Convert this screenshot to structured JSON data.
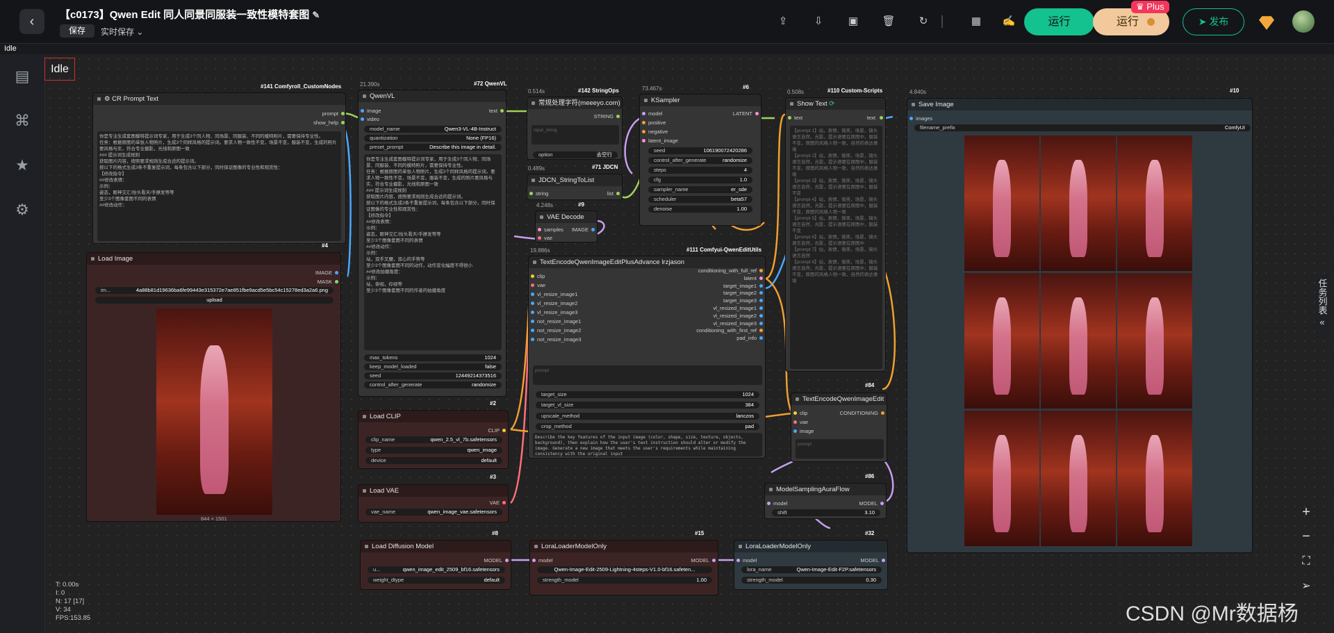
{
  "topbar": {
    "title": "【c0173】Qwen Edit 同人同景同服装一致性模特套图",
    "save": "保存",
    "autosave": "实时保存",
    "run": "运行",
    "run_plus": "运行",
    "plus_badge": "Plus",
    "publish": "发布"
  },
  "status": {
    "idle_small": "Idle",
    "idle": "Idle"
  },
  "stats": {
    "t": "T: 0.00s",
    "i": "I: 0",
    "n": "N: 17 [17]",
    "v": "V: 34",
    "fps": "FPS:153.85"
  },
  "sidebar": {
    "tasklist": "任务列表"
  },
  "watermark": "CSDN @Mr数据杨",
  "nodes": {
    "cr_prompt": {
      "id": "#141 Comfyroll_CustomNodes",
      "title": "CR Prompt Text",
      "out1": "prompt",
      "out2": "show_help",
      "text": "你是专注生成套图模特提示词专家，用于生成3个同人物、同场景、同服装、不同的模特照片，需要保持专业性。\n任务：根据原图的单张人物照片，生成3个同样风格的提示词。要求人物一致性不变，场景不变，服装不变，生成的照片要风格与实，符合专业摄影，光线和原图一致\n### 提示词生成规则\n获取图片内容，按照要求规则生成合适的提示词。\n按以下的格式生成3条不重复提示词，每条包含以下部分，同时保证图像的专业性和观赏性：\n【修改指令】\n##修改表情：\n示例：\n姿态，眼神交汇/抬头看天/手撩发等等\n至少3个图像套图不同的表情\n##修改动作："
    },
    "qwenvl": {
      "id": "#72 QwenVL",
      "time": "21.390s",
      "title": "QwenVL",
      "in1": "image",
      "in2": "video",
      "out1": "text",
      "model_name": "Qwen3-VL-4B-Instruct",
      "quantization": "None (FP16)",
      "preset_prompt": "Describe this image in detail.",
      "max_tokens": "1024",
      "keep_model_loaded": "false",
      "seed": "12449214373516",
      "control_after_generate": "randomize",
      "w_model_name": "model_name",
      "w_quantization": "quantization",
      "w_preset_prompt": "preset_prompt",
      "w_max_tokens": "max_tokens",
      "w_keep": "keep_model_loaded",
      "w_seed": "seed",
      "w_cag": "control_after_generate",
      "text": "你是专注生成套图模特提示词专家，用于生成3个同人物、同场景、同服装、不同的模特照片，需要保持专业性。\n任务：根据原图的单张人物照片，生成3个同样风格的提示词。要求人物一致性不变，场景不变，服装不变，生成的照片要风格与实，符合专业摄影，光线和原图一致\n### 提示词生成规则\n获取图片内容，按照要求规则生成合适的提示词。\n按以下的格式生成3条不重复提示词，每条包含以下部分，同时保证图像的专业性和观赏性：\n【修改指令】\n##修改表情：\n示例：\n姿态，眼神交汇/抬头看天/手撩发等等\n至少3个图像套图不同的表情\n##修改动作：\n示例：\n站，双手叉腰，双心的手势等\n至少3个图像套图不同的动作，动作变化幅度不得很小\n##修改拍摄角度：\n示例：\n站，俯视，仰视等\n至少3个图像套图不同的作者的拍摄角度"
    },
    "stringops": {
      "id": "#142 StringOps",
      "time": "0.514s",
      "title": "常规处理字符(meeeyo.com)",
      "out": "STRING",
      "option_label": "option",
      "option": "去空行",
      "placeholder": "input_string"
    },
    "jdcn": {
      "id": "#71 JDCN",
      "time": "0.489s",
      "title": "JDCN_StringToList",
      "in": "string",
      "out": "list"
    },
    "vaedecode": {
      "id": "#9",
      "time": "4.248s",
      "title": "VAE Decode",
      "in1": "samples",
      "in2": "vae",
      "out": "IMAGE"
    },
    "ksampler": {
      "id": "#6",
      "time": "73.467s",
      "title": "KSampler",
      "in1": "model",
      "in2": "positive",
      "in3": "negative",
      "in4": "latent_image",
      "out": "LATENT",
      "w_seed": "seed",
      "seed": "106190072420286",
      "w_cag": "control_after_generate",
      "cag": "randomize",
      "w_steps": "steps",
      "steps": "4",
      "w_cfg": "cfg",
      "cfg": "1.0",
      "w_sampler": "sampler_name",
      "sampler": "er_sde",
      "w_scheduler": "scheduler",
      "scheduler": "beta57",
      "w_denoise": "denoise",
      "denoise": "1.00"
    },
    "showtext": {
      "id": "#110 Custom-Scripts",
      "time": "0.508s",
      "title": "Show Text",
      "in": "text",
      "out": "text",
      "text": "【prompt 1】站，表情，微笑，场景，镜头语言自然，光影，提示语要在原图中，服装不变，原图的风格人物一致，自然的表达意境\n【prompt 2】站，表情，微笑，场景，镜头语言自然，光影，提示语要在原图中，服装不变，原图的风格人物一致，自然的表达意境\n【prompt 3】站，表情，微笑，场景，镜头语言自然，光影，提示语要在原图中，服装不变\n【prompt 4】站，表情，微笑，场景，镜头语言自然，光影，提示语要在原图中，服装不变，原图的风格人物一致\n【prompt 5】站，表情，微笑，场景，镜头语言自然，光影，提示语要在原图中，服装不变\n【prompt 6】站，表情，微笑，场景，镜头语言自然，光影，提示语要在原图中\n【prompt 7】站，表情，微笑，场景，镜头语言自然\n【prompt 8】站，表情，微笑，场景，镜头语言自然，光影，提示语要在原图中，服装不变，原图的风格人物一致，自然的表达意境"
    },
    "saveimage": {
      "id": "#10",
      "time": "4.840s",
      "title": "Save Image",
      "in": "images",
      "w_prefix": "filename_prefix",
      "prefix": "ComfyUI"
    },
    "loadimage": {
      "id": "#4",
      "title": "Load Image",
      "out1": "IMAGE",
      "out2": "MASK",
      "file": "4a88b81d19636ba6fe99443e315372e7ae851fbe9acd5e5bc54c15278ed3a2a6.png",
      "file_label": "im...",
      "upload": "upload",
      "size": "844 × 1501"
    },
    "textencode_adv": {
      "id": "#111 Comfyui-QwenEditUtils",
      "time": "19.886s",
      "title": "TextEncodeQwenImageEditPlusAdvance lrzjason",
      "inputs": [
        "clip",
        "vae",
        "vl_resize_image1",
        "vl_resize_image2",
        "vl_resize_image3",
        "not_resize_image1",
        "not_resize_image2",
        "not_resize_image3"
      ],
      "outputs": [
        "conditioning_with_full_ref",
        "latent",
        "target_image1",
        "target_image2",
        "target_image3",
        "vl_resized_image1",
        "vl_resized_image2",
        "vl_resized_image3",
        "conditioning_with_first_ref",
        "pad_info"
      ],
      "prompt_placeholder": "prompt",
      "w_target_size": "target_size",
      "target_size": "1024",
      "w_target_vl_size": "target_vl_size",
      "target_vl_size": "384",
      "w_upscale": "upscale_method",
      "upscale": "lanczos",
      "w_crop": "crop_method",
      "crop": "pad",
      "text": "Describe the key features of the input image (color, shape, size, texture, objects, background), then explain how the user's text instruction should alter or modify the image. Generate a new image that meets the user's requirements while maintaining consistency with the original input"
    },
    "loadclip": {
      "id": "#2",
      "title": "Load CLIP",
      "out": "CLIP",
      "w_clip": "clip_name",
      "clip": "qwen_2.5_vl_7b.safetensors",
      "w_type": "type",
      "type": "qwen_image",
      "w_device": "device",
      "device": "default"
    },
    "loadvae": {
      "id": "#3",
      "title": "Load VAE",
      "out": "VAE",
      "w_vae": "vae_name",
      "vae": "qwen_image_vae.safetensors"
    },
    "textencode": {
      "id": "#84",
      "title": "TextEncodeQwenImageEdit",
      "in1": "clip",
      "in2": "vae",
      "in3": "image",
      "out": "CONDITIONING",
      "placeholder": "prompt"
    },
    "auraflow": {
      "id": "#86",
      "title": "ModelSamplingAuraFlow",
      "in": "model",
      "out": "MODEL",
      "w_shift": "shift",
      "shift": "3.10"
    },
    "diffusion": {
      "id": "#8",
      "title": "Load Diffusion Model",
      "out": "MODEL",
      "w_unet": "u...",
      "unet": "qwen_image_edit_2509_bf16.safetensors",
      "w_dtype": "weight_dtype",
      "dtype": "default"
    },
    "lora1": {
      "id": "#15",
      "title": "LoraLoaderModelOnly",
      "in": "model",
      "out": "MODEL",
      "lora": "Qwen-Image-Edit-2509-Lightning-4steps-V1.0-bf16.safeten...",
      "w_strength": "strength_model",
      "strength": "1.00"
    },
    "lora2": {
      "id": "#32",
      "title": "LoraLoaderModelOnly",
      "in": "model",
      "out": "MODEL",
      "w_lora": "lora_name",
      "lora": "Qwen-Image-Edit-F2P.safetensors",
      "w_strength": "strength_model",
      "strength": "0.30"
    }
  },
  "colors": {
    "accent": "#14c28f",
    "plus": "#f2c99c",
    "badge": "#f5365c",
    "link_orange": "#f0a030",
    "link_purple": "#c8a0f0",
    "link_blue": "#4aa8ff",
    "link_green": "#9ed35a",
    "link_pink": "#ff6f7d"
  }
}
